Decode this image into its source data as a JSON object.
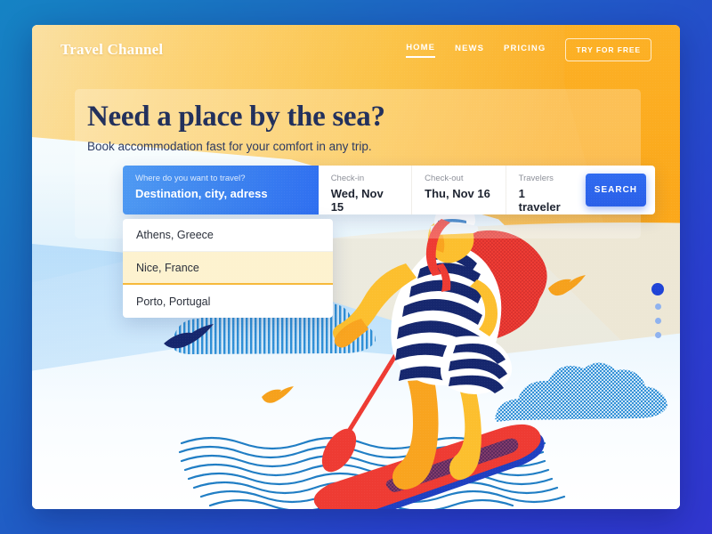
{
  "brand": {
    "name": "Travel Channel"
  },
  "nav": {
    "links": [
      {
        "label": "HOME",
        "active": true
      },
      {
        "label": "NEWS",
        "active": false
      },
      {
        "label": "PRICING",
        "active": false
      }
    ],
    "cta_label": "TRY FOR FREE"
  },
  "hero": {
    "headline": "Need a place by the sea?",
    "subhead": "Book accommodation fast for your comfort in any trip."
  },
  "search": {
    "destination": {
      "label": "Where do you want to travel?",
      "value": "Destination, city, adress"
    },
    "checkin": {
      "label": "Check-in",
      "value": "Wed, Nov 15"
    },
    "checkout": {
      "label": "Check-out",
      "value": "Thu, Nov 16"
    },
    "travelers": {
      "label": "Travelers",
      "value": "1 traveler"
    },
    "button_label": "SEARCH"
  },
  "dropdown": {
    "options": [
      {
        "label": "Athens, Greece",
        "selected": false
      },
      {
        "label": "Nice, France",
        "selected": true
      },
      {
        "label": "Porto, Portugal",
        "selected": false
      }
    ]
  },
  "pagination": {
    "total": 4,
    "active": 1
  },
  "illustration": {
    "subject": "woman paddleboarding",
    "elements": [
      "striped-cloud",
      "dotted-cloud",
      "navy-bird",
      "orange-bird-left",
      "orange-bird-right",
      "sea-waves",
      "red-paddleboard",
      "red-paddle",
      "sailor-cap",
      "red-hair",
      "striped-swimsuit"
    ]
  },
  "colors": {
    "brand_orange": "#fbae26",
    "accent_blue": "#2f6bf0",
    "deep_navy": "#22305c",
    "highlight_yellow": "#fdf2cf",
    "red": "#ee3b33",
    "background_blue": "#2352c8"
  }
}
